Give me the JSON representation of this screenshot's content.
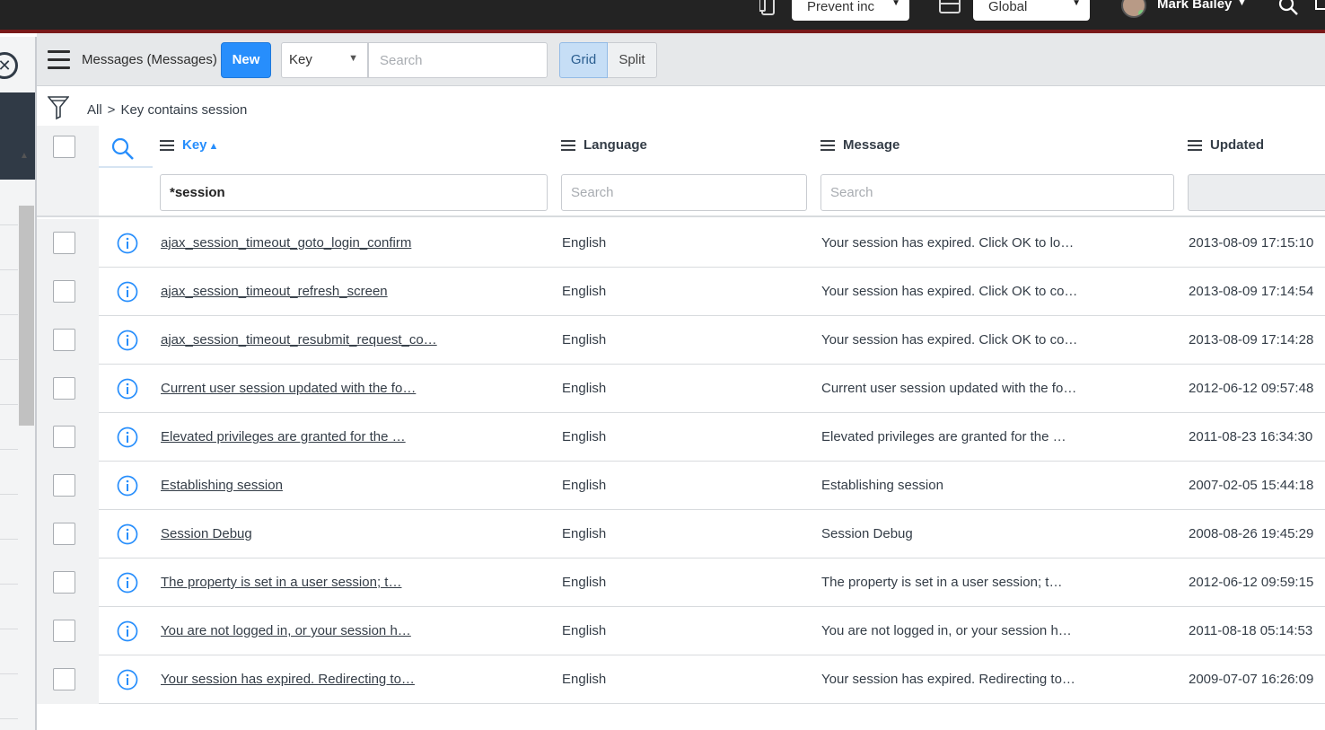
{
  "topbar": {
    "domain_select": "Prevent inc",
    "scope_select": "Global",
    "user_name": "Mark Bailey"
  },
  "list_header": {
    "title": "Messages (Messages)",
    "new_button": "New",
    "field_select": "Key",
    "search_placeholder": "Search",
    "grid_toggle": "Grid",
    "split_toggle": "Split"
  },
  "breadcrumb": {
    "all": "All",
    "separator": ">",
    "condition": "Key contains session"
  },
  "columns": [
    {
      "label": "Key",
      "sorted": "ascending"
    },
    {
      "label": "Language"
    },
    {
      "label": "Message"
    },
    {
      "label": "Updated"
    }
  ],
  "filters": {
    "key_value": "*session",
    "language_placeholder": "Search",
    "message_placeholder": "Search"
  },
  "rows": [
    {
      "key": "ajax_session_timeout_goto_login_confirm",
      "language": "English",
      "message": "Your session has expired. Click OK to lo…",
      "updated": "2013-08-09 17:15:10"
    },
    {
      "key": "ajax_session_timeout_refresh_screen",
      "language": "English",
      "message": "Your session has expired. Click OK to co…",
      "updated": "2013-08-09 17:14:54"
    },
    {
      "key": "ajax_session_timeout_resubmit_request_co…",
      "language": "English",
      "message": "Your session has expired. Click OK to co…",
      "updated": "2013-08-09 17:14:28"
    },
    {
      "key": "Current user session updated with the fo…",
      "language": "English",
      "message": "Current user session updated with the fo…",
      "updated": "2012-06-12 09:57:48"
    },
    {
      "key": "Elevated privileges are granted for the …",
      "language": "English",
      "message": "Elevated privileges are granted for the …",
      "updated": "2011-08-23 16:34:30"
    },
    {
      "key": "Establishing session",
      "language": "English",
      "message": "Establishing session",
      "updated": "2007-02-05 15:44:18"
    },
    {
      "key": "Session Debug",
      "language": "English",
      "message": "Session Debug",
      "updated": "2008-08-26 19:45:29"
    },
    {
      "key": "The property is set in a user session; t…",
      "language": "English",
      "message": "The property is set in a user session; t…",
      "updated": "2012-06-12 09:59:15"
    },
    {
      "key": "You are not logged in, or your session h…",
      "language": "English",
      "message": "You are not logged in, or your session h…",
      "updated": "2011-08-18 05:14:53"
    },
    {
      "key": "Your session has expired. Redirecting to…",
      "language": "English",
      "message": "Your session has expired. Redirecting to…",
      "updated": "2009-07-07 16:26:09"
    }
  ],
  "colors": {
    "accent": "#278efc",
    "topbar": "#232323",
    "topbar_border": "#7a1a1a"
  },
  "icons": [
    "device-icon",
    "window-icon",
    "search-icon",
    "chat-icon",
    "close-circle-icon",
    "hamburger-icon",
    "filter-icon",
    "column-search-icon",
    "column-menu-icon",
    "info-icon"
  ]
}
